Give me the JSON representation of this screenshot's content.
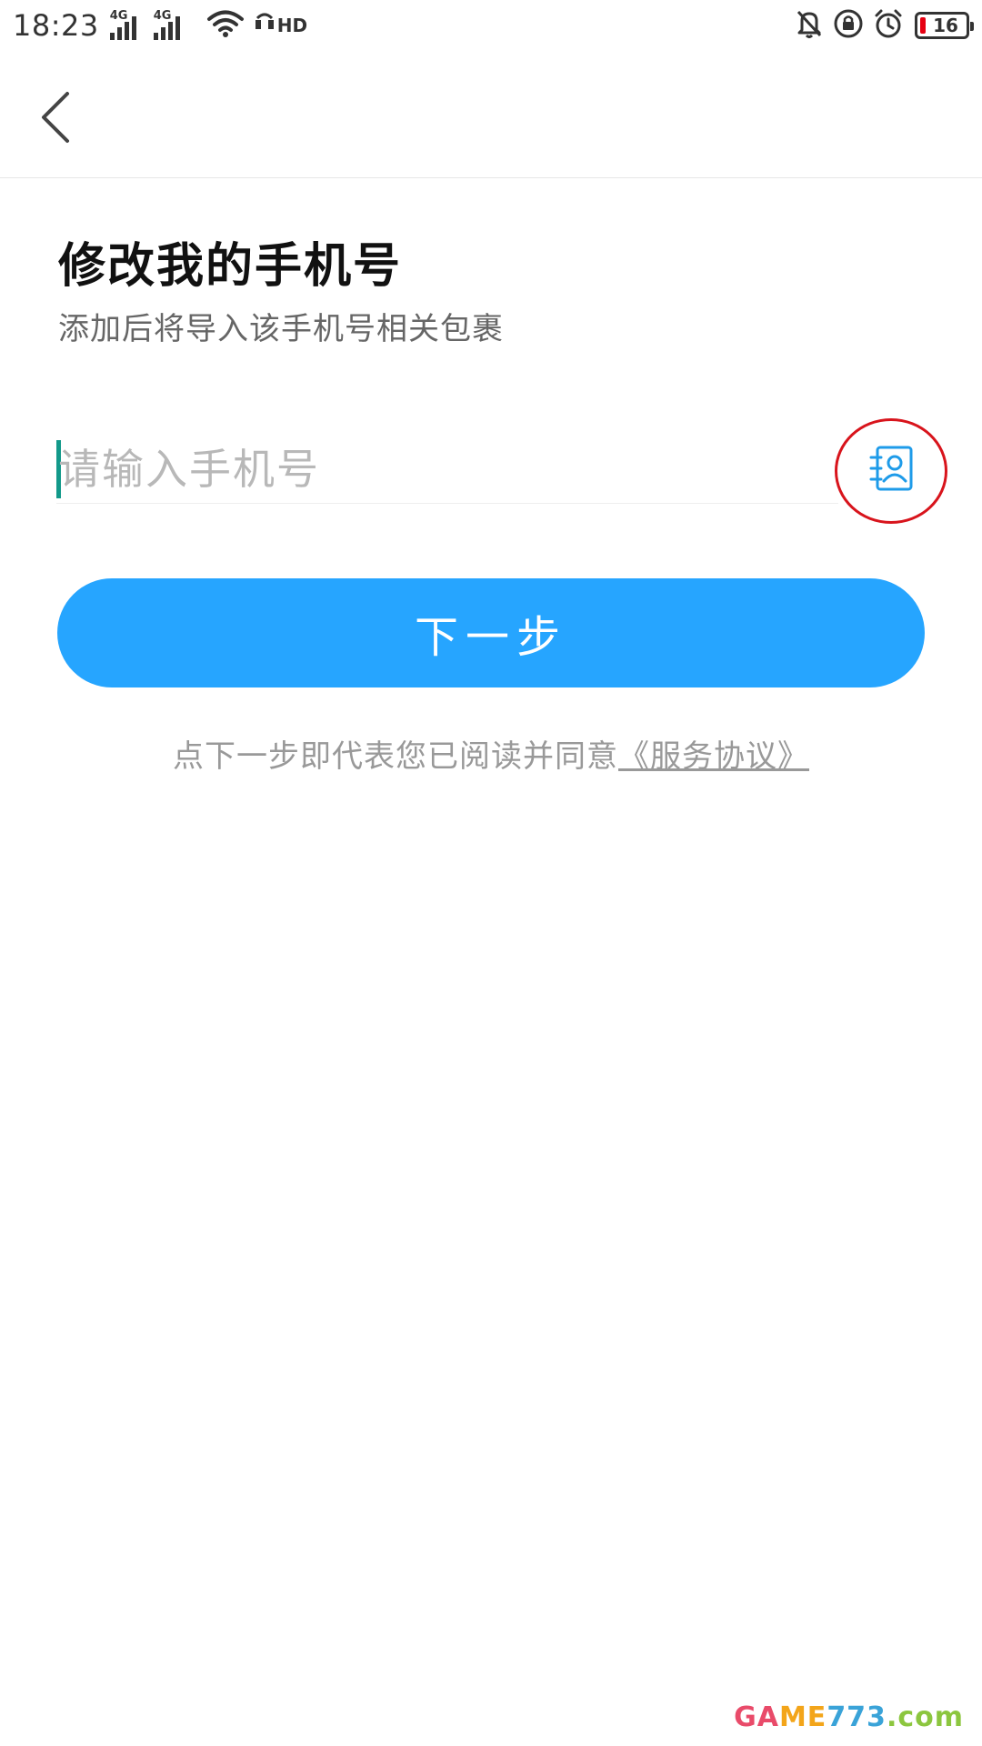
{
  "status_bar": {
    "time": "18:23",
    "network_1": "4G",
    "network_2": "4G",
    "hd_label": "HD",
    "battery_level": "16",
    "icons": [
      "signal-icon",
      "wifi-icon",
      "hd-call-icon",
      "mute-icon",
      "rotation-lock-icon",
      "alarm-icon",
      "battery-icon"
    ]
  },
  "nav": {
    "back_icon": "chevron-left-icon"
  },
  "header": {
    "title": "修改我的手机号",
    "subtitle": "添加后将导入该手机号相关包裹"
  },
  "phone_input": {
    "placeholder": "请输入手机号",
    "value": "",
    "contacts_icon": "contacts-icon"
  },
  "next_button": {
    "label": "下一步",
    "color": "#26a5ff"
  },
  "agreement": {
    "prefix": "点下一步即代表您已阅读并同意",
    "link": "《服务协议》"
  },
  "watermark": {
    "part1": "GA",
    "part2": "ME",
    "part3": "773",
    "part4": ".com"
  },
  "colors": {
    "accent": "#26a5ff",
    "caret": "#12998a",
    "highlight": "#d8141c",
    "battery_low": "#e60012"
  }
}
